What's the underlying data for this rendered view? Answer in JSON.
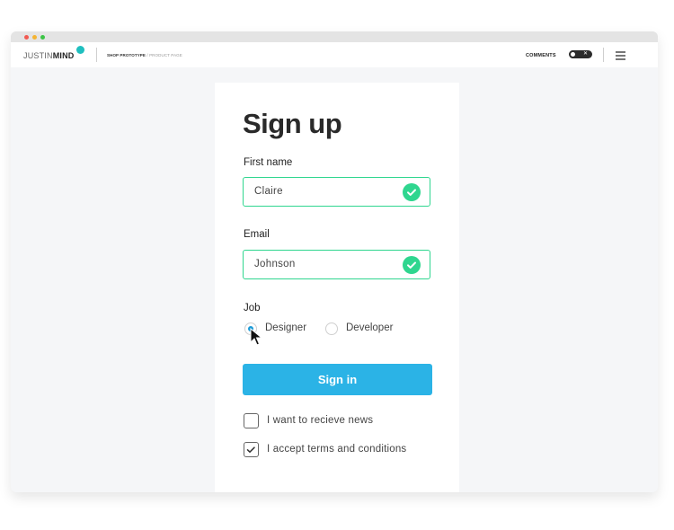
{
  "browser": {
    "dots": [
      "close",
      "minimize",
      "maximize"
    ]
  },
  "appbar": {
    "logo_light": "JUSTIN",
    "logo_bold": "MIND",
    "breadcrumb": {
      "project": "SHOP PROTOTYPE",
      "separator": "/",
      "page": "PRODUCT PAGE"
    },
    "comments_label": "COMMENTS",
    "comments_toggle": {
      "state": "off",
      "x_glyph": "✕"
    },
    "menu_icon": "hamburger-icon"
  },
  "form": {
    "title": "Sign up",
    "first_name": {
      "label": "First name",
      "value": "Claire",
      "valid": true
    },
    "email": {
      "label": "Email",
      "value": "Johnson",
      "valid": true
    },
    "job": {
      "label": "Job",
      "options": [
        {
          "label": "Designer",
          "selected": true
        },
        {
          "label": "Developer",
          "selected": false
        }
      ]
    },
    "submit_label": "Sign in",
    "checkboxes": [
      {
        "label": "I want to recieve news",
        "checked": false
      },
      {
        "label": "I accept terms and conditions",
        "checked": true
      }
    ]
  },
  "colors": {
    "valid_green": "#2fd68f",
    "primary_blue": "#2bb3e6",
    "radio_blue": "#1a9ad6",
    "logo_teal": "#1fbfbf"
  }
}
